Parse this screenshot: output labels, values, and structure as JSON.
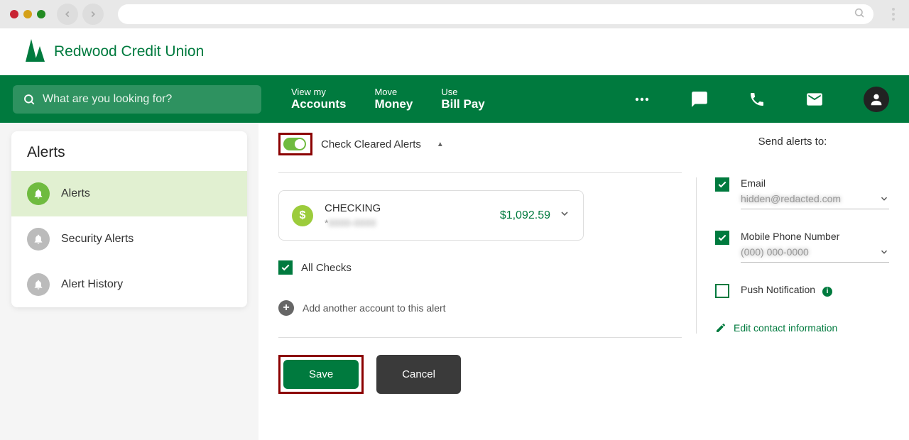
{
  "brand": {
    "name": "Redwood Credit Union"
  },
  "search": {
    "placeholder": "What are you looking for?"
  },
  "nav": {
    "accounts": {
      "top": "View my",
      "bottom": "Accounts"
    },
    "money": {
      "top": "Move",
      "bottom": "Money"
    },
    "billpay": {
      "top": "Use",
      "bottom": "Bill Pay"
    }
  },
  "sidebar": {
    "title": "Alerts",
    "items": [
      {
        "label": "Alerts"
      },
      {
        "label": "Security Alerts"
      },
      {
        "label": "Alert History"
      }
    ]
  },
  "alert": {
    "toggle_label": "Check Cleared Alerts",
    "all_checks": "All Checks",
    "add_account": "Add another account to this alert"
  },
  "account": {
    "name": "CHECKING",
    "mask_prefix": "*",
    "mask_hidden": "0000-0000",
    "balance": "$1,092.59"
  },
  "buttons": {
    "save": "Save",
    "cancel": "Cancel"
  },
  "send_to": {
    "title": "Send alerts to:",
    "email_label": "Email",
    "email_value": "hidden@redacted.com",
    "phone_label": "Mobile Phone Number",
    "phone_value": "(000) 000-0000",
    "push_label": "Push Notification",
    "edit": "Edit contact information"
  }
}
